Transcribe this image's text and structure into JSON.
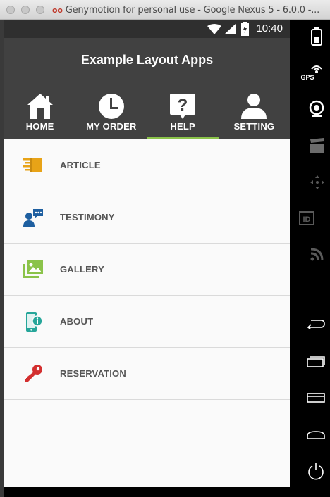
{
  "window": {
    "title": "Genymotion for personal use - Google Nexus 5 - 6.0.0 -...",
    "logo": "oo"
  },
  "status_bar": {
    "time": "10:40"
  },
  "app_bar": {
    "title": "Example Layout Apps"
  },
  "tabs": [
    {
      "label": "HOME",
      "icon": "home-icon",
      "active": false
    },
    {
      "label": "MY ORDER",
      "icon": "clock-icon",
      "active": false
    },
    {
      "label": "HELP",
      "icon": "help-icon",
      "active": true
    },
    {
      "label": "SETTING",
      "icon": "user-icon",
      "active": false
    }
  ],
  "menu": [
    {
      "label": "ARTICLE",
      "icon": "article-icon"
    },
    {
      "label": "TESTIMONY",
      "icon": "testimony-icon"
    },
    {
      "label": "GALLERY",
      "icon": "gallery-icon"
    },
    {
      "label": "ABOUT",
      "icon": "about-icon"
    },
    {
      "label": "RESERVATION",
      "icon": "key-icon"
    }
  ],
  "sidebar": {
    "gps_label": "GPS",
    "id_label": "ID"
  },
  "colors": {
    "app_bar": "#414141",
    "tab_indicator": "#8bc34a",
    "article": "#e8a317",
    "testimony": "#1e5fa0",
    "gallery": "#8bc34a",
    "about": "#26a69a",
    "reservation": "#d32f2f"
  }
}
